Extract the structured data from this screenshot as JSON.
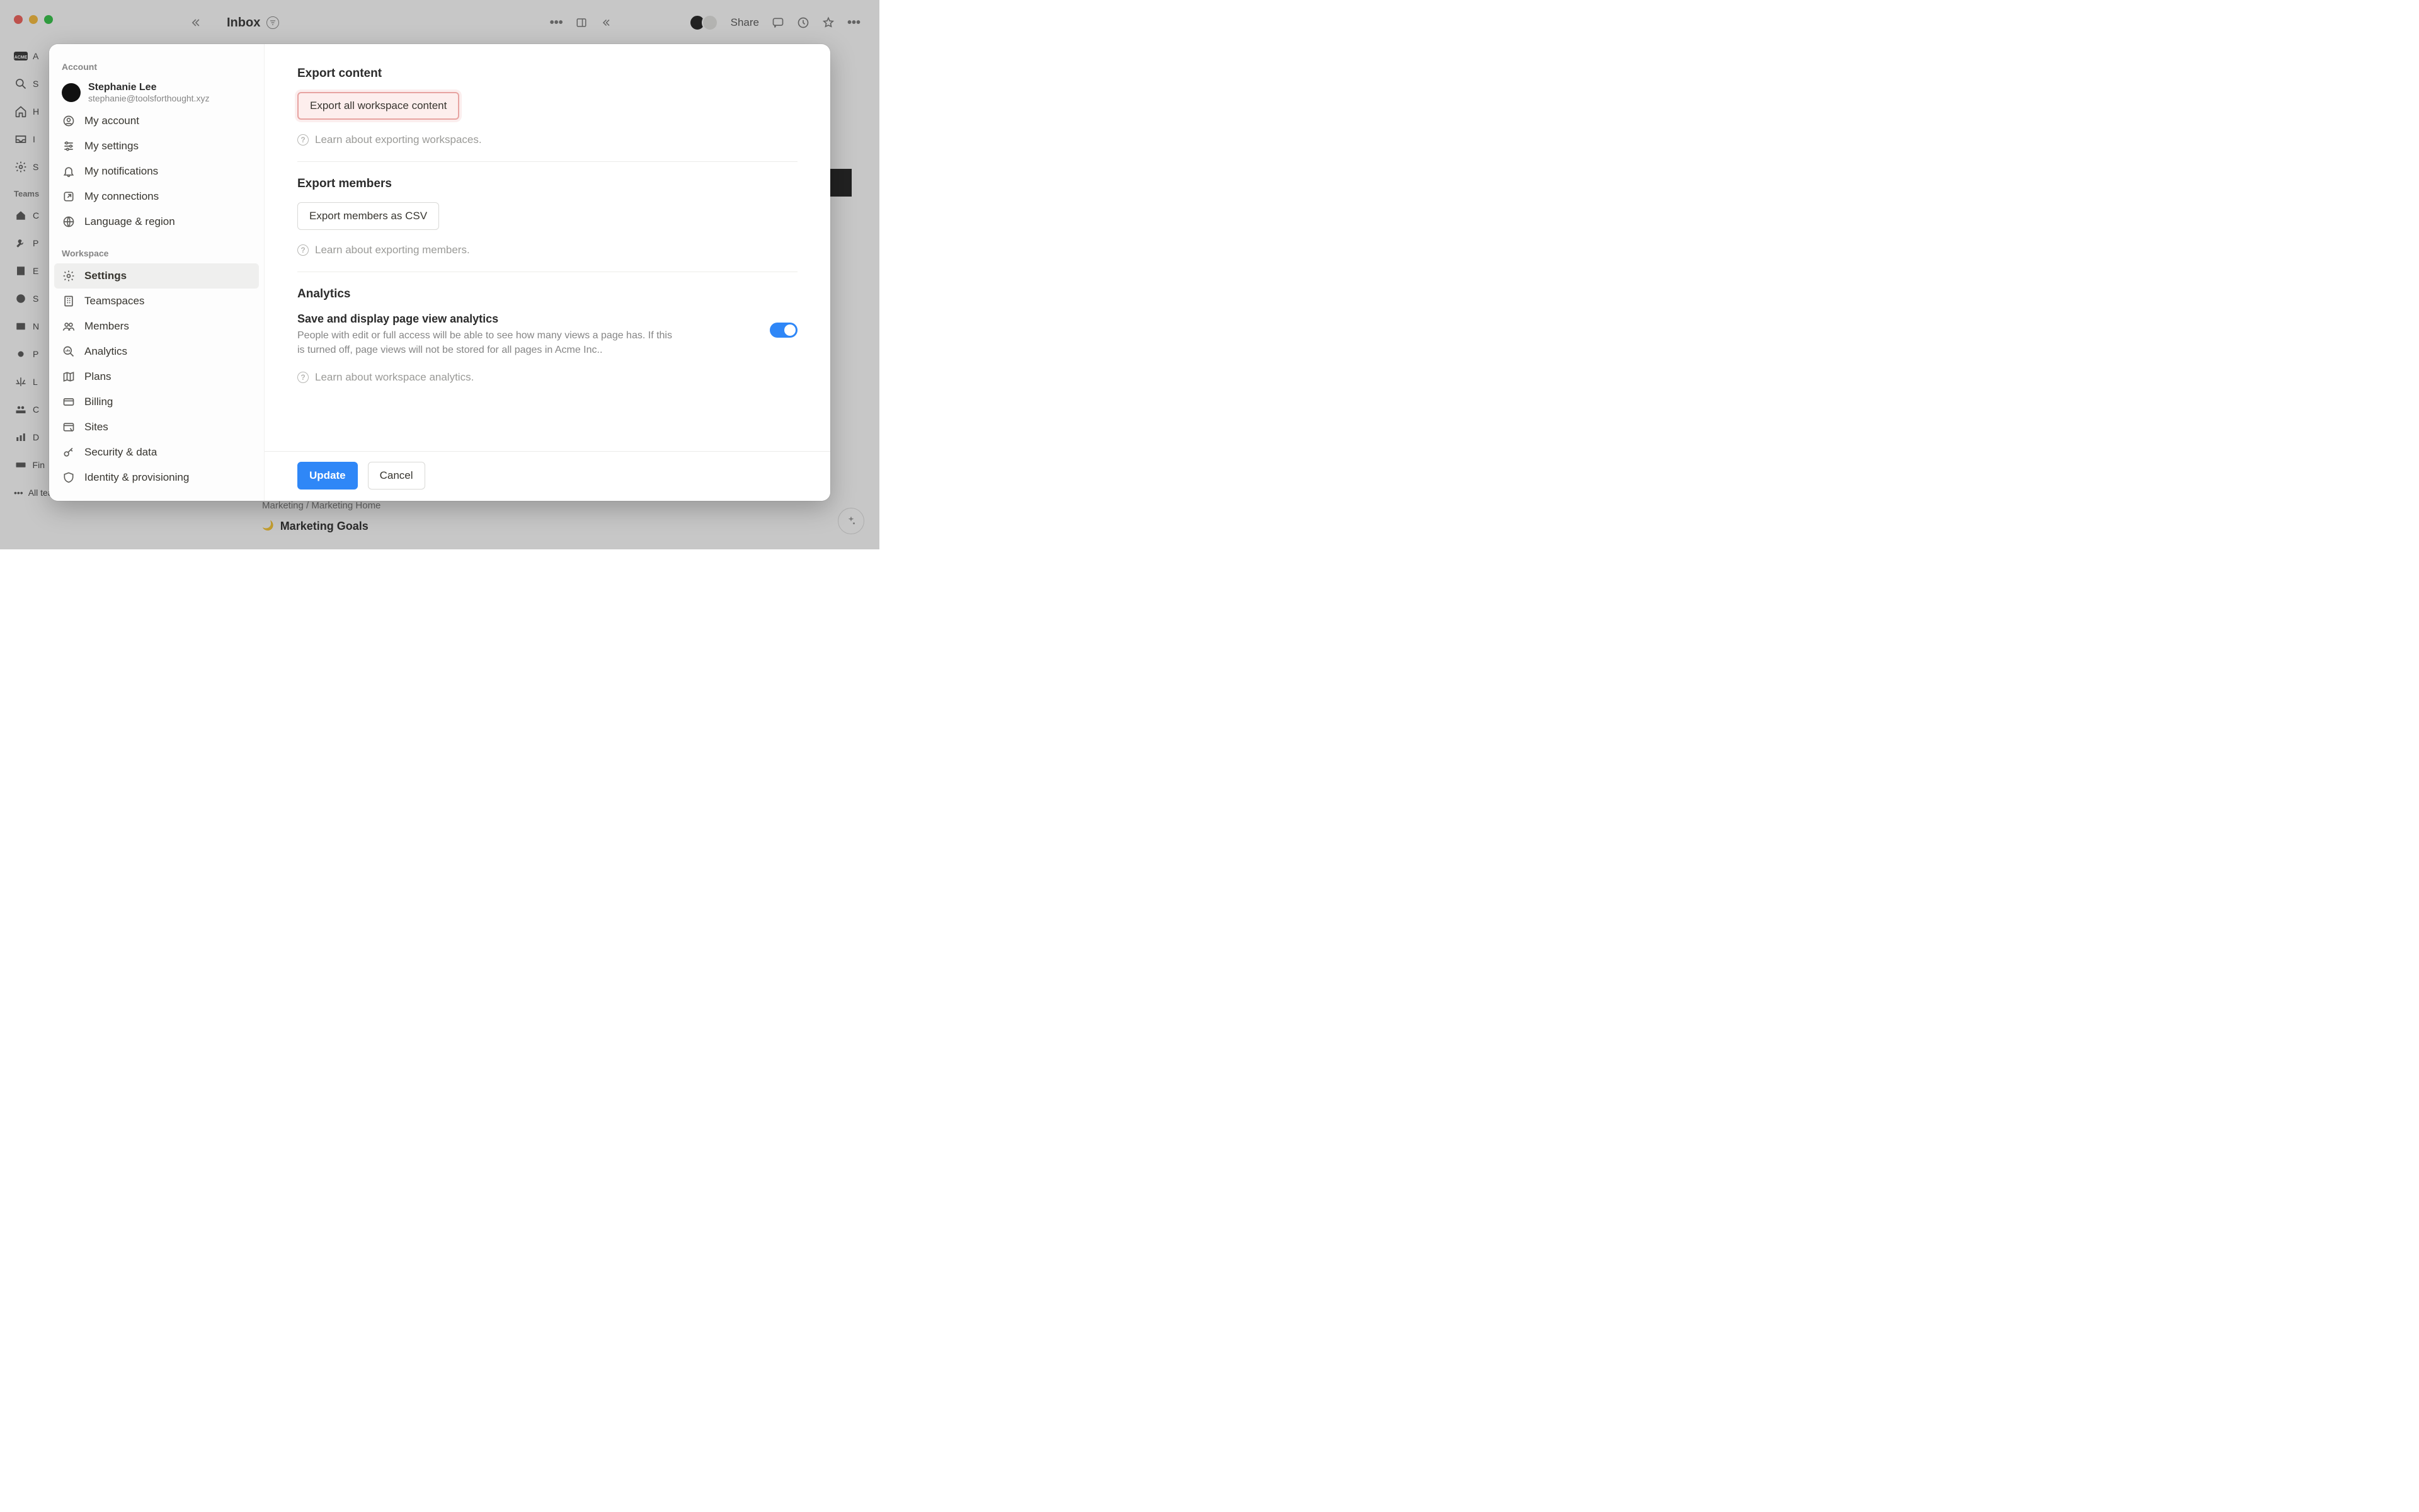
{
  "bg": {
    "topbar": {
      "title": "Inbox",
      "share_label": "Share"
    },
    "bottom": {
      "breadcrumb": "Marketing / Marketing Home",
      "child": "Marketing Goals"
    },
    "rail": {
      "heading": "Teams",
      "all_teamspaces": "All teamspaces"
    }
  },
  "modal": {
    "sections": {
      "account_label": "Account",
      "workspace_label": "Workspace"
    },
    "profile": {
      "name": "Stephanie Lee",
      "email": "stephanie@toolsforthought.xyz"
    },
    "account_items": [
      {
        "label": "My account"
      },
      {
        "label": "My settings"
      },
      {
        "label": "My notifications"
      },
      {
        "label": "My connections"
      },
      {
        "label": "Language & region"
      }
    ],
    "workspace_items": [
      {
        "label": "Settings",
        "active": true
      },
      {
        "label": "Teamspaces"
      },
      {
        "label": "Members"
      },
      {
        "label": "Analytics"
      },
      {
        "label": "Plans"
      },
      {
        "label": "Billing"
      },
      {
        "label": "Sites"
      },
      {
        "label": "Security & data"
      },
      {
        "label": "Identity & provisioning"
      }
    ],
    "right": {
      "export_content": {
        "heading": "Export content",
        "button": "Export all workspace content",
        "learn": "Learn about exporting workspaces."
      },
      "export_members": {
        "heading": "Export members",
        "button": "Export members as CSV",
        "learn": "Learn about exporting members."
      },
      "analytics": {
        "heading": "Analytics",
        "sub": "Save and display page view analytics",
        "desc": "People with edit or full access will be able to see how many views a page has. If this is turned off, page views will not be stored for all pages in Acme Inc..",
        "learn": "Learn about workspace analytics.",
        "toggle_on": true
      },
      "footer": {
        "update": "Update",
        "cancel": "Cancel"
      }
    }
  }
}
